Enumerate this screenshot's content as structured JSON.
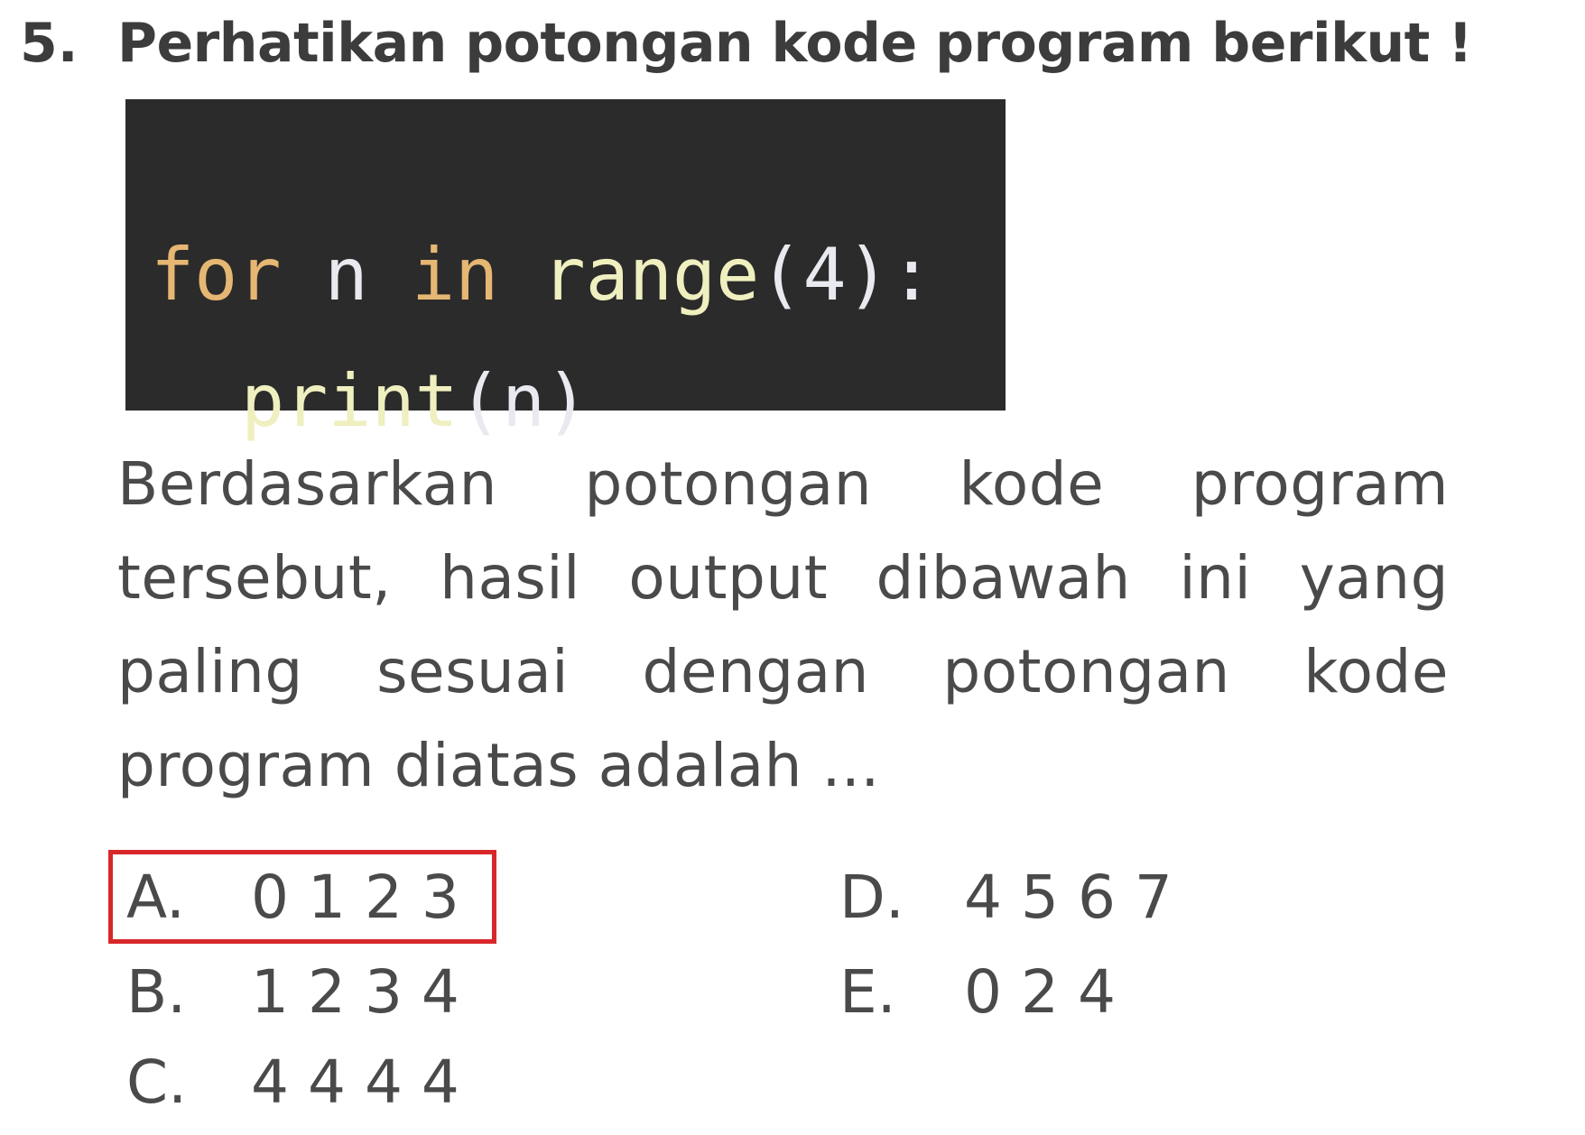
{
  "question": {
    "number": "5.",
    "title": "Perhatikan potongan kode program berikut !",
    "code": {
      "line1": {
        "kw_for": "for",
        "var_n": "n",
        "kw_in": "in",
        "fn_range": "range",
        "args": "(4):"
      },
      "line2": {
        "fn_print": "print",
        "args": "(n)"
      }
    },
    "text": "Berdasarkan potongan kode program tersebut, hasil output dibawah ini yang paling sesuai dengan potongan kode program diatas adalah ..."
  },
  "options": {
    "a": {
      "letter": "A.",
      "value": "0 1 2 3"
    },
    "b": {
      "letter": "B.",
      "value": "1 2 3 4"
    },
    "c": {
      "letter": "C.",
      "value": "4 4 4 4"
    },
    "d": {
      "letter": "D.",
      "value": "4 5 6 7"
    },
    "e": {
      "letter": "E.",
      "value": "0 2 4"
    }
  },
  "highlight_color": "#d8272b",
  "code_background": "#2b2b2b"
}
